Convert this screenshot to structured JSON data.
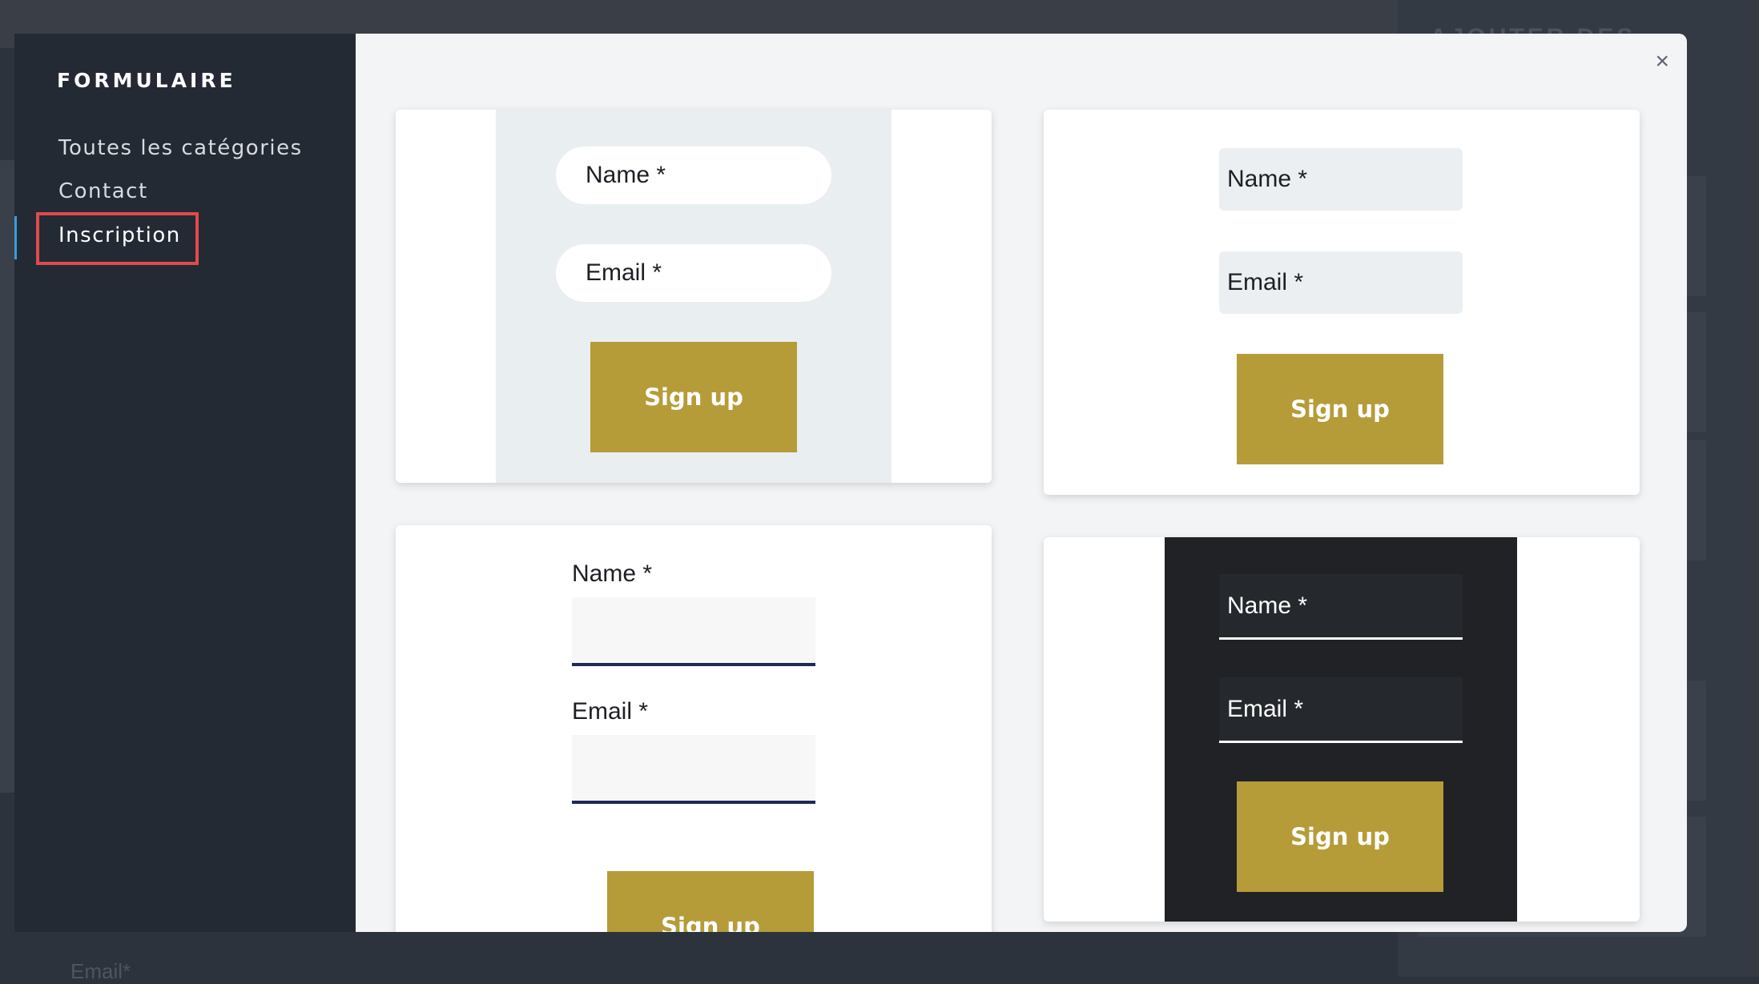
{
  "background": {
    "right_title": "AJOUTER DES ÉLÉMENTS",
    "bottom_text": "Email*"
  },
  "sidebar": {
    "title": "FORMULAIRE",
    "items": [
      {
        "label": "Toutes les catégories"
      },
      {
        "label": "Contact"
      },
      {
        "label": "Inscription"
      }
    ],
    "active_item": "Inscription"
  },
  "modal": {
    "close_label": "×",
    "templates": [
      {
        "name_label": "Name *",
        "email_label": "Email *",
        "button_label": "Sign up"
      },
      {
        "name_label": "Name *",
        "email_label": "Email *",
        "button_label": "Sign up"
      },
      {
        "name_label": "Name *",
        "email_label": "Email *",
        "button_label": "Sign up"
      },
      {
        "name_label": "Name *",
        "email_label": "Email *",
        "button_label": "Sign up"
      }
    ]
  },
  "colors": {
    "accent_button": "#b59c39",
    "sidebar_bg": "#232a33",
    "highlight": "#e04a4f",
    "active_bar": "#3b9be0"
  }
}
